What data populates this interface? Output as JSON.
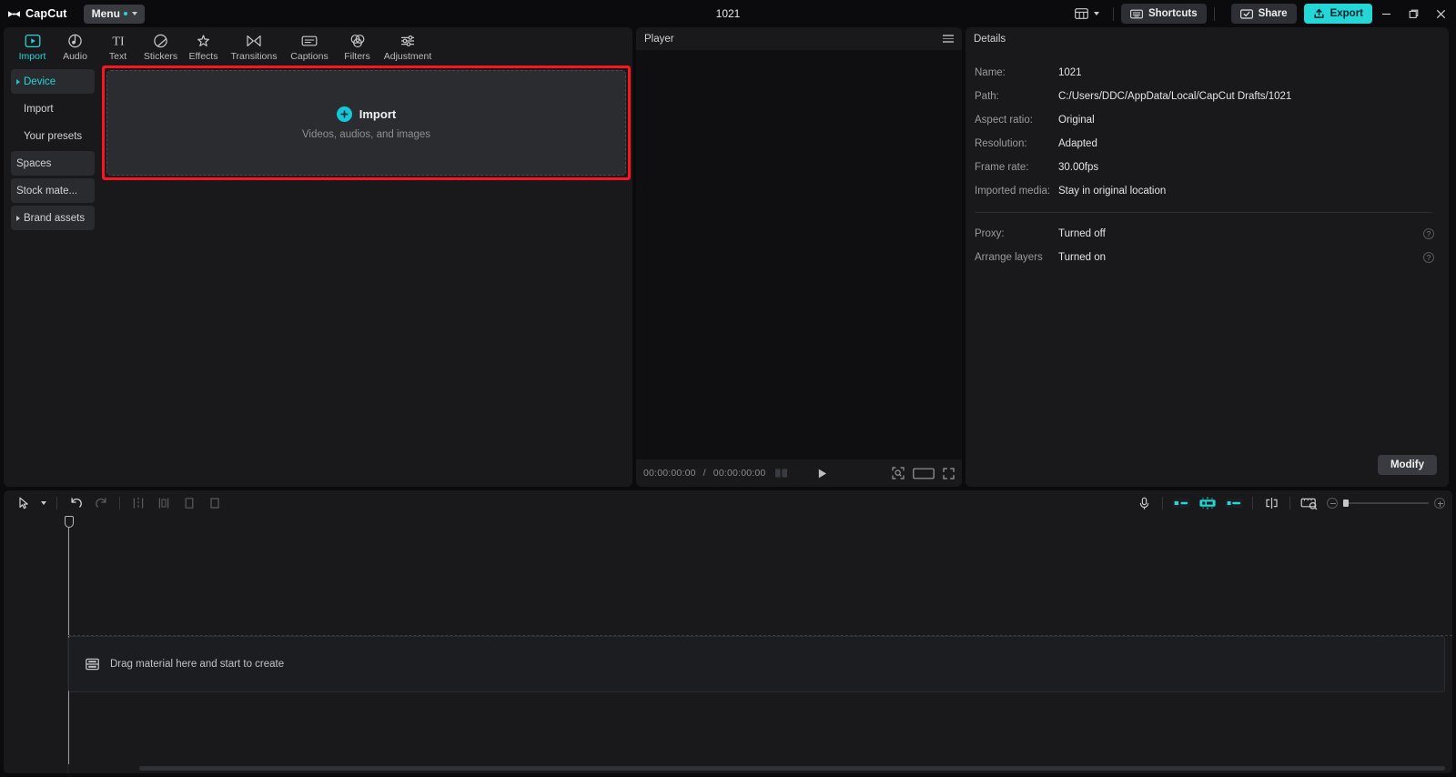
{
  "titlebar": {
    "brand": "CapCut",
    "brand_icon": "capcut-logo-icon",
    "menu_label": "Menu",
    "doc_title": "1021",
    "layout_icon": "layout-icon",
    "shortcuts_label": "Shortcuts",
    "shortcuts_icon": "keyboard-icon",
    "share_label": "Share",
    "share_icon": "share-screen-icon",
    "export_label": "Export",
    "export_icon": "upload-icon",
    "minimize_icon": "minimize-icon",
    "maximize_icon": "maximize-icon",
    "close_icon": "close-icon",
    "accent_color": "#24d6d6"
  },
  "tabs": [
    {
      "label": "Import",
      "icon": "import-icon",
      "active": true
    },
    {
      "label": "Audio",
      "icon": "audio-note-icon",
      "active": false
    },
    {
      "label": "Text",
      "icon": "text-ti-icon",
      "active": false
    },
    {
      "label": "Stickers",
      "icon": "sticker-icon",
      "active": false
    },
    {
      "label": "Effects",
      "icon": "effects-sparkle-icon",
      "active": false
    },
    {
      "label": "Transitions",
      "icon": "transitions-bowtie-icon",
      "active": false
    },
    {
      "label": "Captions",
      "icon": "captions-icon",
      "active": false
    },
    {
      "label": "Filters",
      "icon": "filters-circles-icon",
      "active": false
    },
    {
      "label": "Adjustment",
      "icon": "adjustment-sliders-icon",
      "active": false
    }
  ],
  "sidebar": {
    "items": [
      {
        "label": "Device",
        "style": "active",
        "expandable": true
      },
      {
        "label": "Import",
        "style": "sub",
        "expandable": false
      },
      {
        "label": "Your presets",
        "style": "sub",
        "expandable": false
      },
      {
        "label": "Spaces",
        "style": "chip",
        "expandable": false
      },
      {
        "label": "Stock mate...",
        "style": "chip",
        "expandable": false
      },
      {
        "label": "Brand assets",
        "style": "chip",
        "expandable": true
      }
    ]
  },
  "dropzone": {
    "plus_icon": "plus-circle-icon",
    "title": "Import",
    "subtitle": "Videos, audios, and images",
    "highlight_color": "#fb1520"
  },
  "player": {
    "title": "Player",
    "menu_icon": "hamburger-icon",
    "current_time": "00:00:00:00",
    "separator": "/",
    "total_time": "00:00:00:00",
    "frame_step_icon": "frame-step-icon",
    "play_icon": "play-icon",
    "crop_icon": "crop-focus-icon",
    "ratio_icon": "aspect-ratio-icon",
    "fullscreen_icon": "fullscreen-icon"
  },
  "details": {
    "title": "Details",
    "rows": [
      {
        "label": "Name:",
        "value": "1021",
        "help": false
      },
      {
        "label": "Path:",
        "value": "C:/Users/DDC/AppData/Local/CapCut Drafts/1021",
        "help": false
      },
      {
        "label": "Aspect ratio:",
        "value": "Original",
        "help": false
      },
      {
        "label": "Resolution:",
        "value": "Adapted",
        "help": false
      },
      {
        "label": "Frame rate:",
        "value": "30.00fps",
        "help": false
      },
      {
        "label": "Imported media:",
        "value": "Stay in original location",
        "help": false
      }
    ],
    "rows2": [
      {
        "label": "Proxy:",
        "value": "Turned off",
        "help": true,
        "help_icon": "help-icon"
      },
      {
        "label": "Arrange layers",
        "value": "Turned on",
        "help": true,
        "help_icon": "help-icon"
      }
    ],
    "modify_label": "Modify"
  },
  "timeline": {
    "left_tools": [
      {
        "icon": "cursor-select-icon",
        "name": "select-tool"
      },
      {
        "icon": "chevron-down-icon",
        "name": "select-tool-dropdown"
      },
      {
        "icon": "undo-icon",
        "name": "undo-button"
      },
      {
        "icon": "redo-icon",
        "name": "redo-button"
      },
      {
        "icon": "split-icon",
        "name": "split-button"
      },
      {
        "icon": "trim-left-icon",
        "name": "trim-left-button"
      },
      {
        "icon": "trim-right-icon",
        "name": "trim-right-button"
      },
      {
        "icon": "delete-frame-icon",
        "name": "delete-button"
      }
    ],
    "right_tools": [
      {
        "icon": "microphone-icon",
        "name": "record-voiceover-button",
        "color": "#c8c9cd"
      },
      {
        "icon": "mix-audio-icon",
        "name": "mix-audio-button",
        "color": "#24d6d6"
      },
      {
        "icon": "auto-caption-icon",
        "name": "auto-beat-button",
        "color": "#24d6d6"
      },
      {
        "icon": "link-clip-icon",
        "name": "link-clip-button",
        "color": "#24d6d6"
      },
      {
        "icon": "snap-icon",
        "name": "snap-toggle-button",
        "color": "#c8c9cd"
      },
      {
        "icon": "preview-axis-icon",
        "name": "preview-axis-button",
        "color": "#c8c9cd"
      }
    ],
    "zoom_minus_icon": "zoom-out-icon",
    "zoom_plus_icon": "zoom-in-icon",
    "drop_hint": "Drag material here and start to create",
    "drop_hint_icon": "media-placeholder-icon",
    "playhead_position": "00:00:00:00"
  }
}
